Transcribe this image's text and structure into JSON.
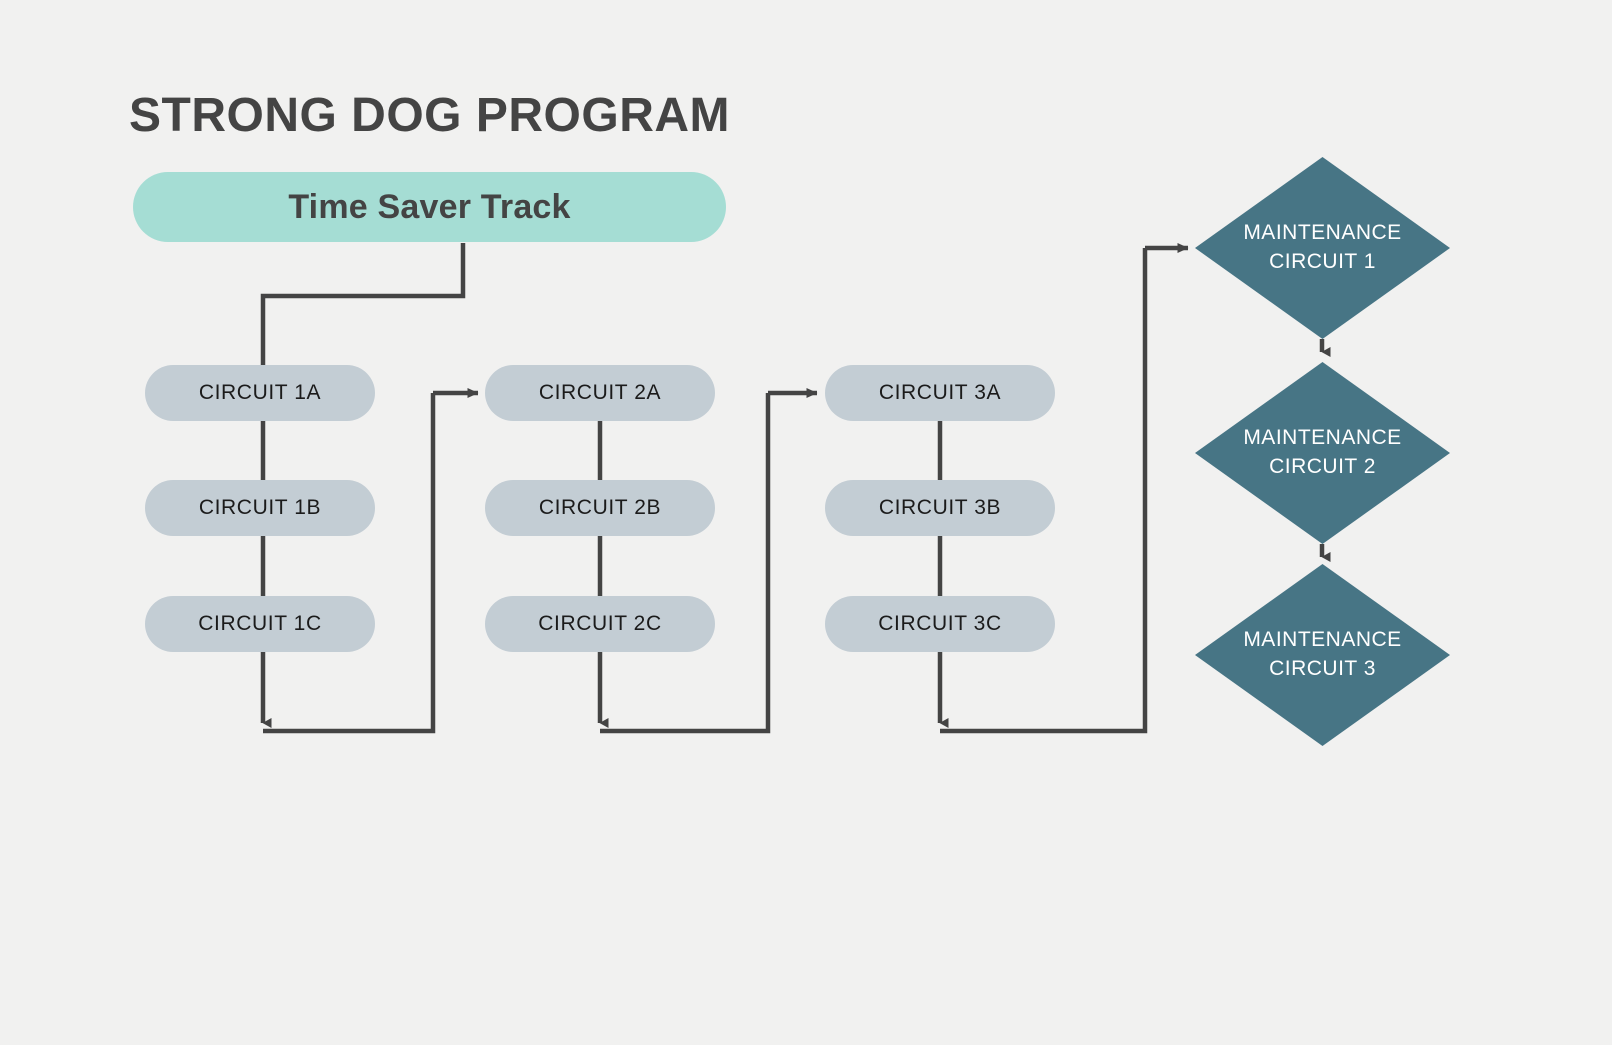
{
  "page": {
    "title": "STRONG DOG PROGRAM",
    "background_color": "#f1f1f0"
  },
  "track": {
    "label": "Time Saver Track",
    "fill_color": "#a5ddd4",
    "text_color": "#444444"
  },
  "colors": {
    "circuit_fill": "#c3cdd4",
    "circuit_text": "#1b1b1b",
    "diamond_fill": "#477585",
    "diamond_text": "#ffffff",
    "connector": "#444444",
    "title_text": "#444444"
  },
  "columns": [
    {
      "name": "column-1",
      "nodes": [
        {
          "label": "CIRCUIT 1A"
        },
        {
          "label": "CIRCUIT 1B"
        },
        {
          "label": "CIRCUIT 1C"
        }
      ]
    },
    {
      "name": "column-2",
      "nodes": [
        {
          "label": "CIRCUIT 2A"
        },
        {
          "label": "CIRCUIT 2B"
        },
        {
          "label": "CIRCUIT 2C"
        }
      ]
    },
    {
      "name": "column-3",
      "nodes": [
        {
          "label": "CIRCUIT 3A"
        },
        {
          "label": "CIRCUIT 3B"
        },
        {
          "label": "CIRCUIT 3C"
        }
      ]
    }
  ],
  "maintenance": [
    {
      "line1": "MAINTENANCE",
      "line2": "CIRCUIT 1"
    },
    {
      "line1": "MAINTENANCE",
      "line2": "CIRCUIT 2"
    },
    {
      "line1": "MAINTENANCE",
      "line2": "CIRCUIT 3"
    }
  ]
}
